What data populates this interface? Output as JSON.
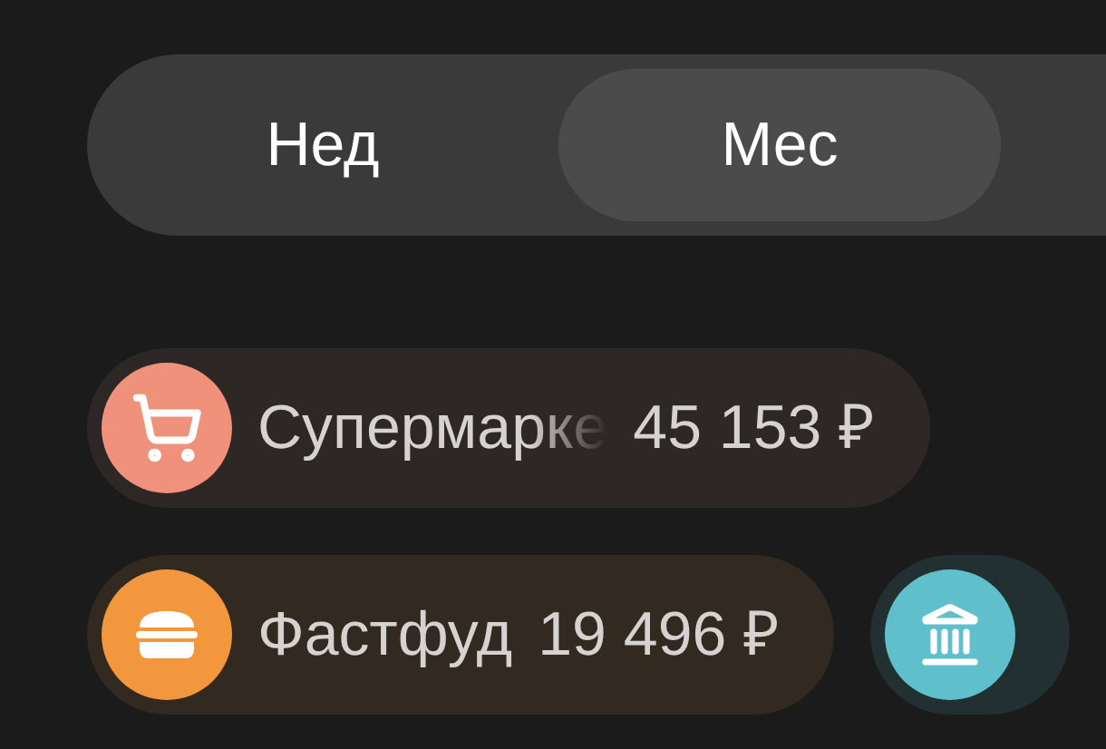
{
  "period_tabs": [
    {
      "label": "Нед",
      "selected": false
    },
    {
      "label": "Мес",
      "selected": true
    }
  ],
  "categories": [
    {
      "kind": "cart",
      "name": "Супермарке",
      "amount": "45 153 ₽",
      "color": "#ef917b"
    },
    {
      "kind": "burger",
      "name": "Фастфуд",
      "amount": "19 496 ₽",
      "color": "#f3973f"
    },
    {
      "kind": "bank",
      "color": "#5fc0cb"
    }
  ]
}
